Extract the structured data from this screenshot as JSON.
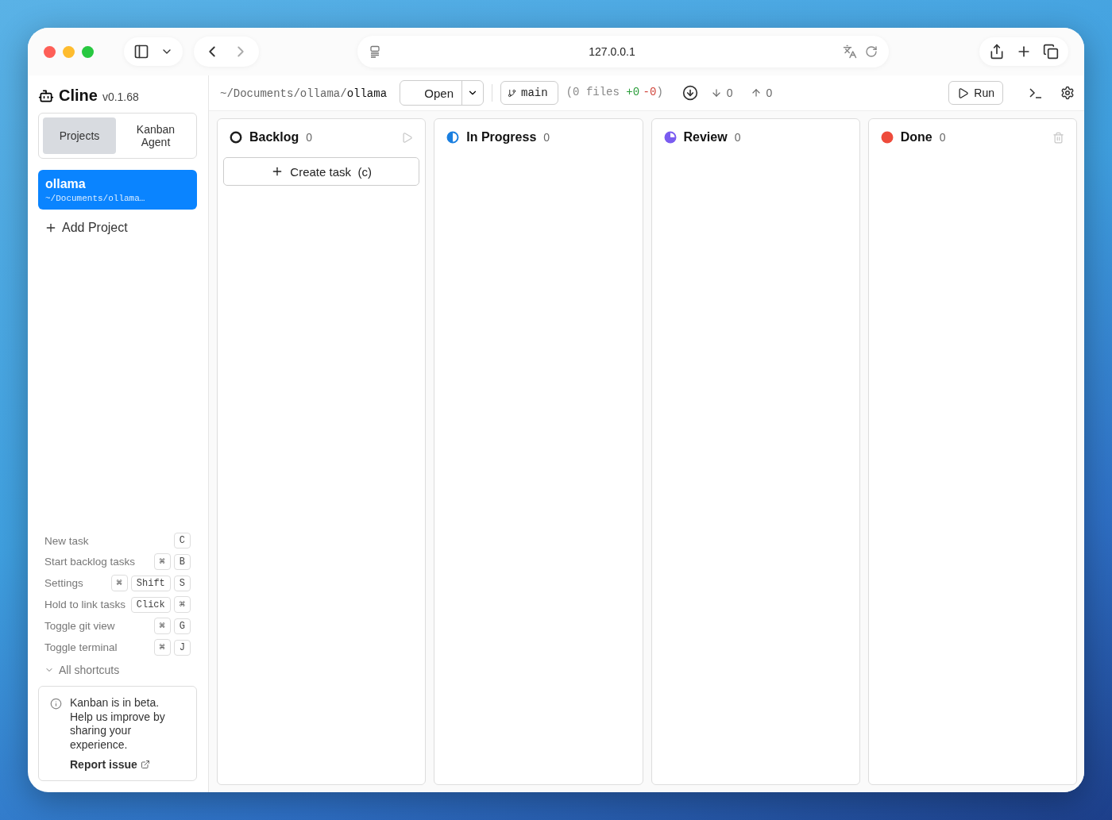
{
  "browser": {
    "url": "127.0.0.1"
  },
  "sidebar": {
    "brand": {
      "name": "Cline",
      "version": "v0.1.68"
    },
    "tabs": [
      {
        "label": "Projects",
        "selected": true
      },
      {
        "label": "Kanban Agent",
        "selected": false
      }
    ],
    "projects": [
      {
        "name": "ollama",
        "path": "~/Documents/ollama…",
        "selected": true
      }
    ],
    "add_project": "Add Project",
    "shortcuts": [
      {
        "label": "New task",
        "keys": [
          "C"
        ]
      },
      {
        "label": "Start backlog tasks",
        "keys": [
          "⌘",
          "B"
        ]
      },
      {
        "label": "Settings",
        "keys": [
          "⌘",
          "Shift",
          "S"
        ]
      },
      {
        "label": "Hold to link tasks",
        "keys": [
          "Click",
          "⌘"
        ]
      },
      {
        "label": "Toggle git view",
        "keys": [
          "⌘",
          "G"
        ]
      },
      {
        "label": "Toggle terminal",
        "keys": [
          "⌘",
          "J"
        ]
      }
    ],
    "all_shortcuts": "All shortcuts",
    "beta_notice": {
      "text": "Kanban is in beta. Help us improve by sharing your experience.",
      "link": "Report issue"
    }
  },
  "toolbar": {
    "path_prefix": "~/Documents/ollama/",
    "path_name": "ollama",
    "open_button": "Open",
    "branch": "main",
    "diff": {
      "open": "(0 files",
      "added": "+0",
      "removed": "-0",
      "close": ")"
    },
    "behind": "0",
    "ahead": "0",
    "run_button": "Run"
  },
  "columns": [
    {
      "title": "Backlog",
      "count": "0",
      "kind": "ring",
      "color": "#1f1f1f",
      "start_all": true,
      "create_task": "Create task",
      "create_hint": "(c)"
    },
    {
      "title": "In Progress",
      "count": "0",
      "kind": "half",
      "color": "#1a7fe0"
    },
    {
      "title": "Review",
      "count": "0",
      "kind": "pie",
      "color": "#7a5cf0"
    },
    {
      "title": "Done",
      "count": "0",
      "kind": "dot",
      "color": "#ee4b3b",
      "clear_all": true
    }
  ]
}
